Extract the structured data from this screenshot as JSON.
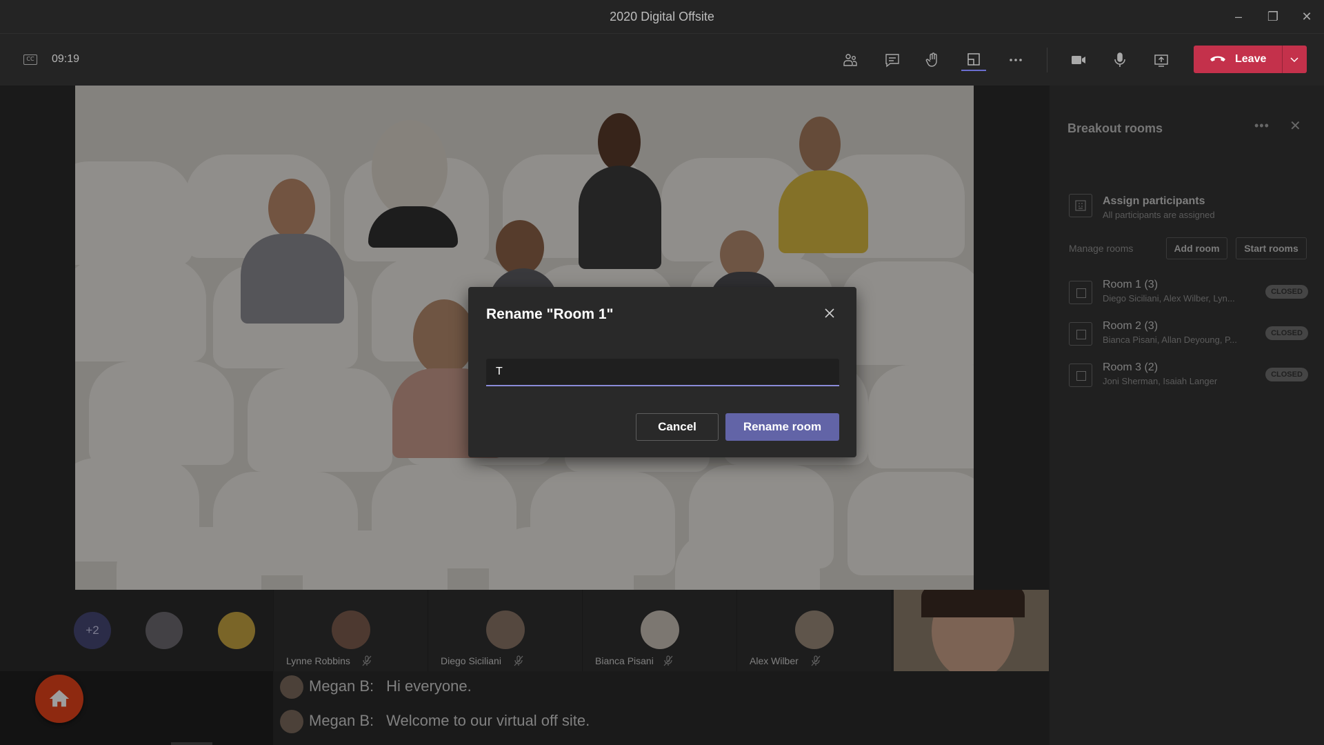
{
  "window": {
    "title": "2020 Digital Offsite"
  },
  "toolbar": {
    "timer": "09:19",
    "leave_label": "Leave"
  },
  "participants": {
    "overflow_count": "+2",
    "tiles": [
      {
        "name": "Lynne Robbins"
      },
      {
        "name": "Diego Siciliani"
      },
      {
        "name": "Bianca Pisani"
      },
      {
        "name": "Alex Wilber"
      }
    ]
  },
  "chat": [
    {
      "sender": "Megan B:",
      "message": "Hi everyone."
    },
    {
      "sender": "Megan B:",
      "message": "Welcome to our virtual off site."
    }
  ],
  "panel": {
    "title": "Breakout rooms",
    "assign": {
      "title": "Assign participants",
      "subtitle": "All participants are assigned"
    },
    "manage_label": "Manage rooms",
    "add_room_label": "Add room",
    "start_rooms_label": "Start rooms",
    "rooms": [
      {
        "name": "Room 1 (3)",
        "members": "Diego Siciliani, Alex Wilber, Lyn...",
        "status": "CLOSED"
      },
      {
        "name": "Room 2 (3)",
        "members": "Bianca Pisani, Allan Deyoung, P...",
        "status": "CLOSED"
      },
      {
        "name": "Room 3 (2)",
        "members": "Joni Sherman, Isaiah Langer",
        "status": "CLOSED"
      }
    ]
  },
  "dialog": {
    "title": "Rename \"Room 1\"",
    "input_value": "T",
    "cancel_label": "Cancel",
    "confirm_label": "Rename room"
  },
  "colors": {
    "accent": "#6264a7",
    "leave": "#c4314b",
    "home_button": "#e6431a"
  }
}
